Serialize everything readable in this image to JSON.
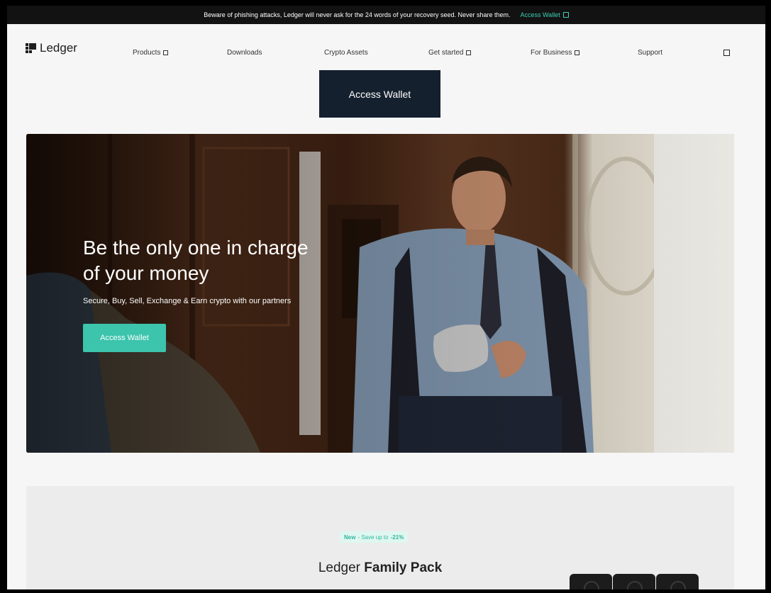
{
  "banner": {
    "text": "Beware of phishing attacks, Ledger will never ask for the 24 words of your recovery seed. Never share them.",
    "link": "Access Wallet"
  },
  "nav": {
    "logo": "Ledger",
    "items": [
      {
        "label": "Products",
        "has_dropdown": true
      },
      {
        "label": "Downloads",
        "has_dropdown": false
      },
      {
        "label": "Crypto Assets",
        "has_dropdown": false
      },
      {
        "label": "Get started",
        "has_dropdown": true
      },
      {
        "label": "For Business",
        "has_dropdown": true
      },
      {
        "label": "Support",
        "has_dropdown": false
      }
    ],
    "cta": "Access Wallet"
  },
  "hero": {
    "title": "Be the only one in charge of your money",
    "subtitle": "Secure, Buy, Sell, Exchange & Earn crypto with our partners",
    "button": "Access Wallet"
  },
  "promo": {
    "badge_new": "New",
    "badge_rest": "- Save up to",
    "badge_percent": "-21%",
    "title_light": "Ledger",
    "title_bold": "Family Pack"
  },
  "colors": {
    "accent": "#3cc4ad",
    "dark": "#15202e",
    "banner_bg": "#121212"
  }
}
